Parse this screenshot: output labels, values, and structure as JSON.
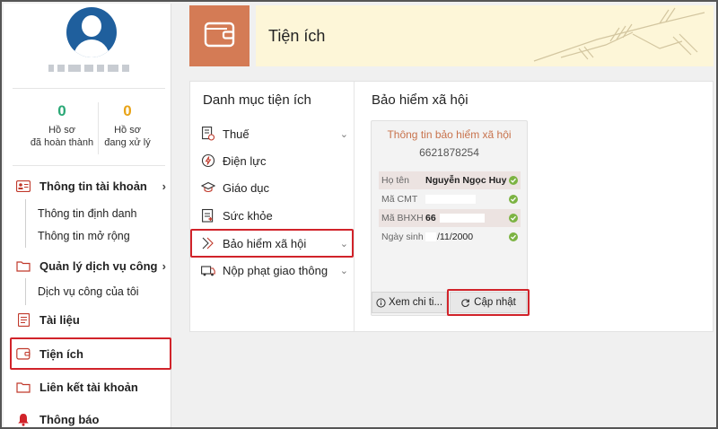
{
  "sidebar": {
    "stats": [
      {
        "value": "0",
        "label_line1": "Hồ sơ",
        "label_line2": "đã hoàn thành",
        "color": "#2aa876"
      },
      {
        "value": "0",
        "label_line1": "Hồ sơ",
        "label_line2": "đang xử lý",
        "color": "#e8a317"
      }
    ],
    "account_info": "Thông tin tài khoản",
    "account_sub": [
      "Thông tin định danh",
      "Thông tin mở rộng"
    ],
    "public_service": "Quản lý dịch vụ công",
    "public_service_sub": [
      "Dịch vụ công của tôi"
    ],
    "documents": "Tài liệu",
    "utilities": "Tiện ích",
    "linked_accounts": "Liên kết tài khoản",
    "notifications": "Thông báo"
  },
  "header": {
    "title": "Tiện ích",
    "accent_color": "#d47b55"
  },
  "categories": {
    "title": "Danh mục tiện ích",
    "items": [
      {
        "label": "Thuế",
        "icon": "tax-icon"
      },
      {
        "label": "Điện lực",
        "icon": "electricity-icon"
      },
      {
        "label": "Giáo dục",
        "icon": "education-icon"
      },
      {
        "label": "Sức khỏe",
        "icon": "health-icon"
      },
      {
        "label": "Bảo hiểm xã hội",
        "icon": "insurance-icon"
      },
      {
        "label": "Nộp phạt giao thông",
        "icon": "traffic-fine-icon"
      }
    ]
  },
  "insurance": {
    "title": "Bảo hiểm xã hội",
    "card_title": "Thông tin bảo hiểm xã hội",
    "card_id": "6621878254",
    "rows": [
      {
        "key": "Họ tên",
        "value": "Nguyễn Ngọc Huy"
      },
      {
        "key": "Mã CMT",
        "value": ""
      },
      {
        "key": "Mã BHXH",
        "value": "66"
      },
      {
        "key": "Ngày sinh",
        "value": "/11/2000"
      }
    ],
    "detail_button": "Xem chi ti...",
    "update_button": "Cập nhật"
  }
}
